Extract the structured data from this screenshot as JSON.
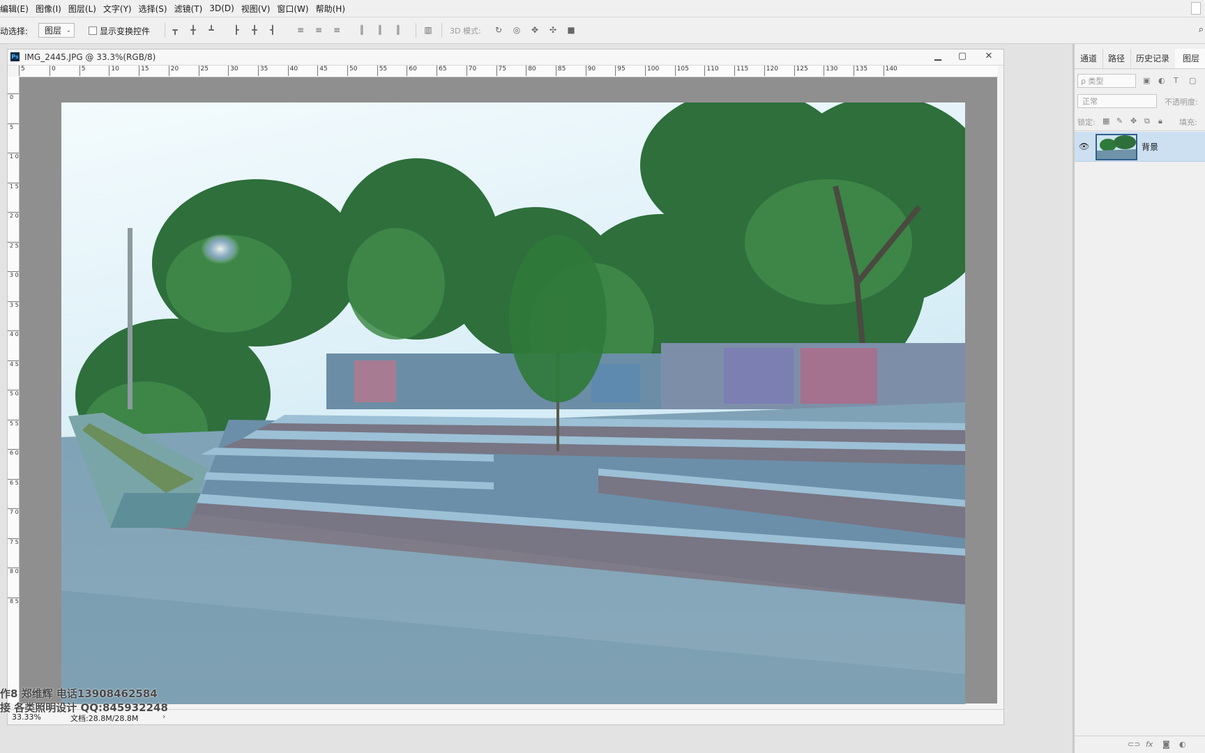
{
  "menu": [
    "编辑(E)",
    "图像(I)",
    "图层(L)",
    "文字(Y)",
    "选择(S)",
    "滤镜(T)",
    "3D(D)",
    "视图(V)",
    "窗口(W)",
    "帮助(H)"
  ],
  "options": {
    "auto_select_label": "动选择:",
    "auto_select_value": "图层",
    "show_transform_label": "显示变换控件",
    "mode_3d_label": "3D 模式:"
  },
  "document": {
    "title": "IMG_2445.JPG @ 33.3%(RGB/8)",
    "zoom": "33.33%",
    "doc_size": "文档:28.8M/28.8M",
    "h_ruler_ticks": [
      "5",
      "0",
      "5",
      "10",
      "15",
      "20",
      "25",
      "30",
      "35",
      "40",
      "45",
      "50",
      "55",
      "60",
      "65",
      "70",
      "75",
      "80",
      "85",
      "90",
      "95",
      "100",
      "105",
      "110",
      "115",
      "120",
      "125",
      "130",
      "135",
      "140"
    ],
    "v_ruler_ticks": [
      "0",
      "5",
      "1 0",
      "1 5",
      "2 0",
      "2 5",
      "3 0",
      "3 5",
      "4 0",
      "4 5",
      "5 0",
      "5 5",
      "6 0",
      "6 5",
      "7 0",
      "7 5",
      "8 0",
      "8 5"
    ],
    "watermark_line1": "作8  郑维辉  电话13908462584",
    "watermark_line2": "接 各类照明设计 QQ:845932248"
  },
  "panel": {
    "tabs": [
      "通道",
      "路径",
      "历史记录",
      "图层"
    ],
    "active_tab": "图层",
    "filter_placeholder": "ρ 类型",
    "blend_mode": "正常",
    "opacity_label": "不透明度:",
    "lock_label": "锁定:",
    "fill_label": "填充:",
    "layer_name": "背景"
  },
  "colors": {
    "sky": "#e6f3f8",
    "foliage": "#2f7a3a",
    "steps": "#5a8fb0",
    "selection": "#cde0f2"
  }
}
